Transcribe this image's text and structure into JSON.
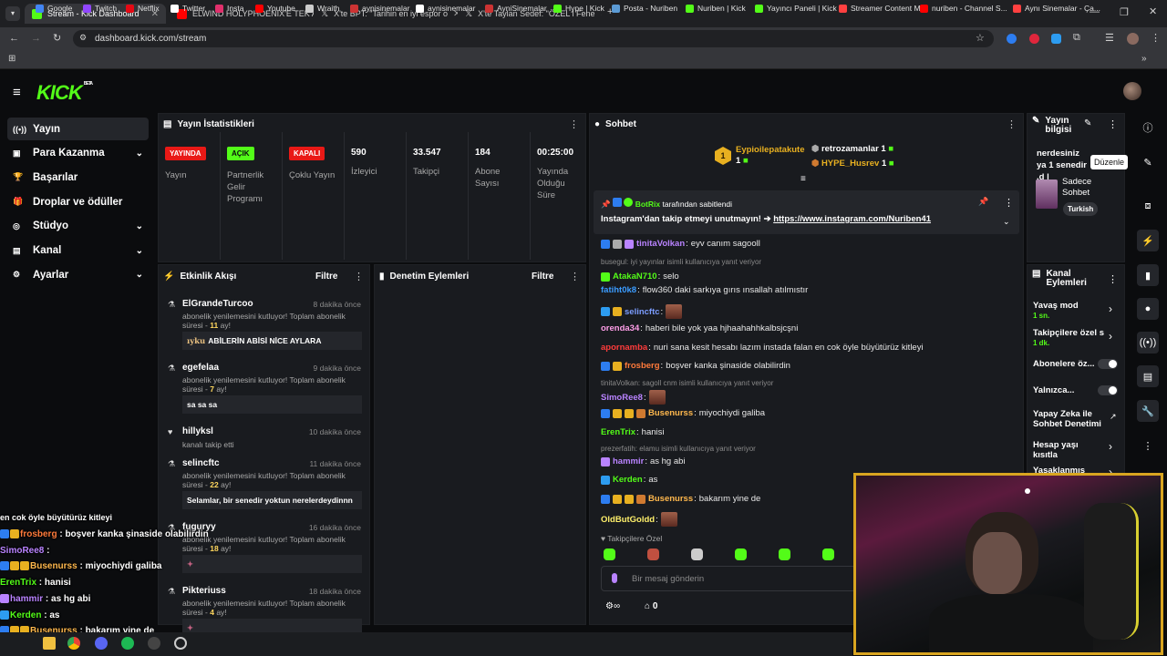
{
  "browser": {
    "tabs": [
      {
        "title": "Stream - Kick Dashboard",
        "favicon_color": "#53fc18"
      },
      {
        "title": "ELWIND HOLYPHOENIX'E TEK A",
        "favicon_color": "#ff0000"
      },
      {
        "title": "X'te BPT: \"Tarihin en iyi espor o",
        "favicon_color": "#ffffff"
      },
      {
        "title": "X'te Taylan Sedef: \"ÖZEL l Fene",
        "favicon_color": "#ffffff"
      }
    ],
    "url": "dashboard.kick.com/stream",
    "bookmarks": [
      "Google",
      "Twitch",
      "Netflix",
      "Twitter",
      "Insta",
      "Youtube",
      "Wraith",
      "aynisinemalar",
      "aynisinemalar",
      "AyniSinemalar",
      "Hype | Kick",
      "Posta - Nuriben",
      "Nuriben | Kick",
      "Yayıncı Paneli | Kick",
      "Streamer Content M...",
      "nuriben - Channel S...",
      "Aynı Sinemalar - Ça..."
    ]
  },
  "header": {
    "logo": "KICK",
    "logo_sup": "BETA"
  },
  "sidebar": {
    "items": [
      {
        "label": "Yayın",
        "icon": "broadcast-icon",
        "chevron": false
      },
      {
        "label": "Para Kazanma",
        "icon": "money-icon",
        "chevron": true
      },
      {
        "label": "Başarılar",
        "icon": "trophy-icon",
        "chevron": false
      },
      {
        "label": "Droplar ve ödüller",
        "icon": "gift-icon",
        "chevron": false
      },
      {
        "label": "Stüdyo",
        "icon": "studio-icon",
        "chevron": true
      },
      {
        "label": "Kanal",
        "icon": "channel-icon",
        "chevron": true
      },
      {
        "label": "Ayarlar",
        "icon": "settings-icon",
        "chevron": true
      }
    ]
  },
  "stats": {
    "title": "Yayın İstatistikleri",
    "badges": [
      {
        "badge": "YAYINDA",
        "label": "Yayın",
        "color": "#e91916"
      },
      {
        "badge": "AÇIK",
        "label": "Partnerlik Gelir Programı",
        "color": "#53fc18"
      },
      {
        "badge": "KAPALI",
        "label": "Çoklu Yayın",
        "color": "#e91916"
      }
    ],
    "numbers": [
      {
        "value": "590",
        "label": "İzleyici"
      },
      {
        "value": "33.547",
        "label": "Takipçi"
      },
      {
        "value": "184",
        "label": "Abone Sayısı"
      },
      {
        "value": "00:25:00",
        "label": "Yayında Olduğu Süre"
      }
    ]
  },
  "activity": {
    "title": "Etkinlik Akışı",
    "filter": "Filtre",
    "items": [
      {
        "name": "ElGrandeTurcoo",
        "time": "8 dakika önce",
        "desc_a": "abonelik yenilemesini kutluyor! Toplam abonelik",
        "desc_b": "süresi - ",
        "months": "11",
        "desc_c": " ay!",
        "message": "ABİLERİN ABİSİ NİCE AYLARA",
        "emote": "ıyku"
      },
      {
        "name": "egefelaa",
        "time": "9 dakika önce",
        "desc_a": "abonelik yenilemesini kutluyor! Toplam abonelik",
        "desc_b": "süresi - ",
        "months": "7",
        "desc_c": " ay!",
        "message": "sa sa sa"
      },
      {
        "name": "hillyksl",
        "time": "10 dakika önce",
        "desc": "kanalı takip etti"
      },
      {
        "name": "selincftc",
        "time": "11 dakika önce",
        "desc_a": "abonelik yenilemesini kutluyor! Toplam abonelik",
        "desc_b": "süresi - ",
        "months": "22",
        "desc_c": " ay!",
        "message": "Selamlar, bir senedir yoktun nerelerdeydinnn"
      },
      {
        "name": "fuguryy",
        "time": "16 dakika önce",
        "desc_a": "abonelik yenilemesini kutluyor! Toplam abonelik",
        "desc_b": "süresi - ",
        "months": "18",
        "desc_c": " ay!"
      },
      {
        "name": "Pikteriuss",
        "time": "18 dakika önce",
        "desc_a": "abonelik yenilemesini kutluyor! Toplam abonelik",
        "desc_b": "süresi - ",
        "months": "4",
        "desc_c": " ay!"
      }
    ]
  },
  "moderation": {
    "title": "Denetim Eylemleri",
    "filter": "Filtre"
  },
  "chat": {
    "title": "Sohbet",
    "top_gifters": [
      {
        "name": "Eypioilepatakute",
        "count": "1",
        "rank": "1"
      },
      {
        "name": "retrozamanlar",
        "count": "1"
      },
      {
        "name": "HYPE_Husrev",
        "count": "1"
      }
    ],
    "pinned_by": "BotRix",
    "pinned_suffix": "tarafından sabitlendi",
    "pinned_text": "Instagram'dan takip etmeyi unutmayın! ➔",
    "pinned_link": "https://www.instagram.com/Nuriben41",
    "messages": [
      {
        "user": "tinitaVolkan",
        "color": "#b983ff",
        "text": "eyv canım sagooll"
      },
      {
        "reply": "busegul: iyi yayınlar isimli kullanıcıya yanıt veriyor"
      },
      {
        "user": "AtakaN710",
        "color": "#53fc18",
        "text": "selo"
      },
      {
        "user": "fatiht0k8",
        "color": "#3b9cff",
        "text": "flow360 daki sarkıya gırıs ınsallah atılmıstır"
      },
      {
        "user": "selincftc",
        "color": "#7b9cff",
        "text": ""
      },
      {
        "user": "orenda34",
        "color": "#ff9ee8",
        "text": "haberi bile yok yaa hjhaahahhkalbsjcşni"
      },
      {
        "user": "apornamba",
        "color": "#ff3b3b",
        "text": "nuri sana kesit hesabı lazım instada falan en cok öyle büyütürüz kitleyi"
      },
      {
        "user": "frosberg",
        "color": "#ff7a3b",
        "text": "boşver kanka şinaside olabilirdin"
      },
      {
        "reply": "tinitaVolkan: sagoll cnm isimli kullanıcıya yanıt veriyor"
      },
      {
        "user": "SimoRee8",
        "color": "#b983ff",
        "text": ""
      },
      {
        "user": "Busenurss",
        "color": "#ffb84d",
        "text": "miyochiydi galiba"
      },
      {
        "user": "ErenTrix",
        "color": "#53fc18",
        "text": "hanisi"
      },
      {
        "reply": "prezerfatih: elamu isimli kullanıcıya yanıt veriyor"
      },
      {
        "user": "hammir",
        "color": "#b983ff",
        "text": "as hg abi"
      },
      {
        "user": "Kerden",
        "color": "#53fc18",
        "text": "as"
      },
      {
        "user": "Busenurss",
        "color": "#ffb84d",
        "text": "bakarım yine de"
      },
      {
        "user": "OldButGoldd",
        "color": "#fff06b",
        "text": ""
      }
    ],
    "followers_only": "Takipçilere Özel",
    "input_placeholder": "Bir mesaj gönderin",
    "points": "0"
  },
  "stream_info": {
    "title": "Yayın bilgisi",
    "tooltip": "Düzenle",
    "stream_title": "nerdesiniz ya 1 senedir .d |",
    "category": "Sadece Sohbet",
    "language": "Turkish"
  },
  "channel_actions": {
    "title": "Kanal Eylemleri",
    "items": [
      {
        "label": "Yavaş mod",
        "sub": "1 sn.",
        "control": "chevron"
      },
      {
        "label": "Takipçilere özel s",
        "sub": "1 dk.",
        "control": "chevron"
      },
      {
        "label": "Abonelere öz...",
        "sub": "",
        "control": "toggle"
      },
      {
        "label": "Yalnızca...",
        "sub": "",
        "control": "toggle"
      },
      {
        "label": "Yapay Zeka ile Sohbet Denetimi",
        "sub": "",
        "control": "external"
      },
      {
        "label": "Hesap yaşı kısıtla",
        "sub": "",
        "control": "chevron"
      },
      {
        "label": "Yasaklanmış kelin",
        "sub": "",
        "control": "chevron"
      }
    ]
  },
  "overlay": {
    "lines": [
      {
        "user": "",
        "color": "#ffffff",
        "text": "en cok öyle büyütürüz kitleyi"
      },
      {
        "user": "frosberg",
        "color": "#ff7a3b",
        "text": " : boşver kanka şinaside olabilirdin"
      },
      {
        "user": "SimoRee8",
        "color": "#b983ff",
        "text": " :"
      },
      {
        "user": "Busenurss",
        "color": "#ffb84d",
        "text": " : miyochiydi galiba"
      },
      {
        "user": "ErenTrix",
        "color": "#53fc18",
        "text": " : hanisi"
      },
      {
        "user": "hammir",
        "color": "#b983ff",
        "text": " : as hg abi"
      },
      {
        "user": "Kerden",
        "color": "#53fc18",
        "text": " : as"
      },
      {
        "user": "Busenurss",
        "color": "#ffb84d",
        "text": " : bakarım yine de"
      },
      {
        "user": "OldButGoldd",
        "color": "#fff06b",
        "text": " :"
      }
    ]
  },
  "colors": {
    "brand": "#53fc18",
    "panel": "#191b1f",
    "bg": "#0b0c0e",
    "webcam_border": "#d9a520"
  }
}
